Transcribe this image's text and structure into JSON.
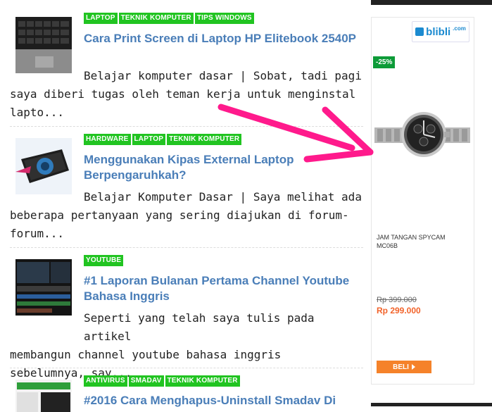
{
  "posts": [
    {
      "tags": [
        "LAPTOP",
        "TEKNIK KOMPUTER",
        "TIPS WINDOWS"
      ],
      "title": "Cara Print Screen di Laptop HP Elitebook 2540P",
      "excerpt_first": "Belajar komputer dasar | Sobat, tadi pagi",
      "excerpt_rest": "saya diberi tugas oleh teman kerja untuk menginstal lapto..."
    },
    {
      "tags": [
        "HARDWARE",
        "LAPTOP",
        "TEKNIK KOMPUTER"
      ],
      "title": "Menggunakan Kipas External Laptop Berpengaruhkah?",
      "excerpt_first": "Belajar Komputer Dasar | Saya melihat ada",
      "excerpt_rest": "beberapa pertanyaan yang sering diajukan di forum-forum..."
    },
    {
      "tags": [
        "YOUTUBE"
      ],
      "title": "#1 Laporan Bulanan Pertama Channel Youtube Bahasa Inggris",
      "excerpt_first": "Seperti yang telah saya tulis pada artikel",
      "excerpt_rest": "membangun channel youtube bahasa inggris sebelumnya, say..."
    },
    {
      "tags": [
        "ANTIVIRUS",
        "SMADAV",
        "TEKNIK KOMPUTER"
      ],
      "title": "#2016 Cara Menghapus-Uninstall Smadav Di",
      "excerpt_first": "",
      "excerpt_rest": ""
    }
  ],
  "ad": {
    "brand": "blibli",
    "brand_suffix": ".com",
    "discount": "-25%",
    "product_name": "JAM TANGAN SPYCAM MC06B",
    "old_price": "Rp 399.000",
    "new_price": "Rp 299.000",
    "buy_label": "BELI",
    "colors": {
      "brand": "#1b8ad0",
      "discount": "#0d9b38",
      "price": "#f2632a",
      "button": "#f5822a"
    }
  },
  "annotation": {
    "arrow_color": "#ff1a8c"
  },
  "colors": {
    "tag_bg": "#21c421",
    "title": "#4a7eb8"
  }
}
